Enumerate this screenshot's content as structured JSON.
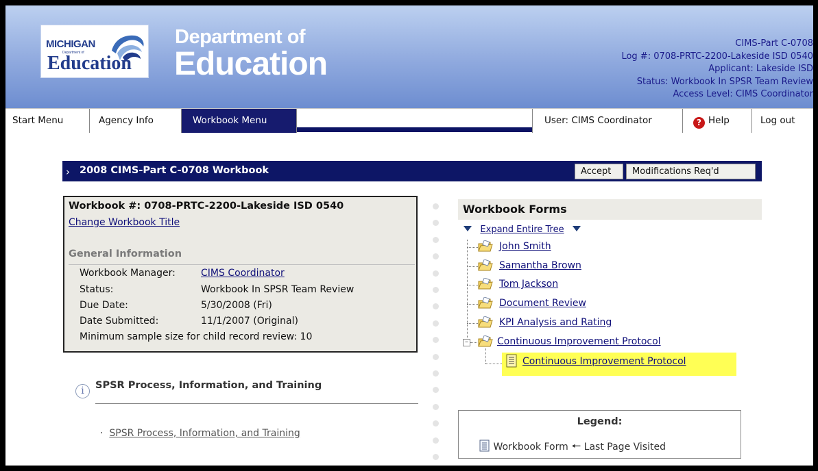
{
  "header": {
    "logo": {
      "line1": "MICHIGAN",
      "line2": "Department of",
      "line3": "Education"
    },
    "title_line1": "Department of",
    "title_line2": "Education",
    "info_lines": [
      "CIMS-Part C-0708",
      "Log #: 0708-PRTC-2200-Lakeside ISD 0540",
      "Applicant: Lakeside ISD",
      "Status: Workbook In SPSR Team Review",
      "Access Level: CIMS Coordinator"
    ]
  },
  "nav": {
    "tabs": [
      "Start Menu",
      "Agency Info",
      "Workbook Menu"
    ],
    "active_tab": "Workbook Menu",
    "user": "User: CIMS Coordinator",
    "help": "Help",
    "logout": "Log out",
    "active_color": "#161b6e"
  },
  "workbook_bar": {
    "title": "2008 CIMS-Part C-0708 Workbook",
    "accept": "Accept",
    "modifications": "Modifications Req'd"
  },
  "workbook_box": {
    "number": "Workbook #: 0708-PRTC-2200-Lakeside ISD 0540",
    "change_title": "Change Workbook Title",
    "general_info": "General Information",
    "manager_label": "Workbook Manager:",
    "manager_value": "CIMS Coordinator",
    "status_label": "Status:",
    "status_value": "Workbook In SPSR Team Review",
    "due_label": "Due Date:",
    "due_value": "5/30/2008 (Fri)",
    "submitted_label": "Date Submitted:",
    "submitted_value": "11/1/2007 (Original)",
    "sample_size": "Minimum sample size for child record review: 10"
  },
  "spsr": {
    "title": "SPSR Process, Information, and Training",
    "link": "SPSR Process, Information, and Training"
  },
  "workbook_forms": {
    "heading": "Workbook Forms",
    "expand": "Expand Entire Tree",
    "items": [
      "John Smith",
      "Samantha Brown",
      "Tom Jackson",
      "Document Review",
      "KPI Analysis and Rating",
      "Continuous Improvement Protocol"
    ],
    "child": "Continuous Improvement Protocol",
    "highlight_color": "#ffff55"
  },
  "legend": {
    "title": "Legend:",
    "form": "Workbook Form",
    "last_page": "Last Page Visited"
  }
}
